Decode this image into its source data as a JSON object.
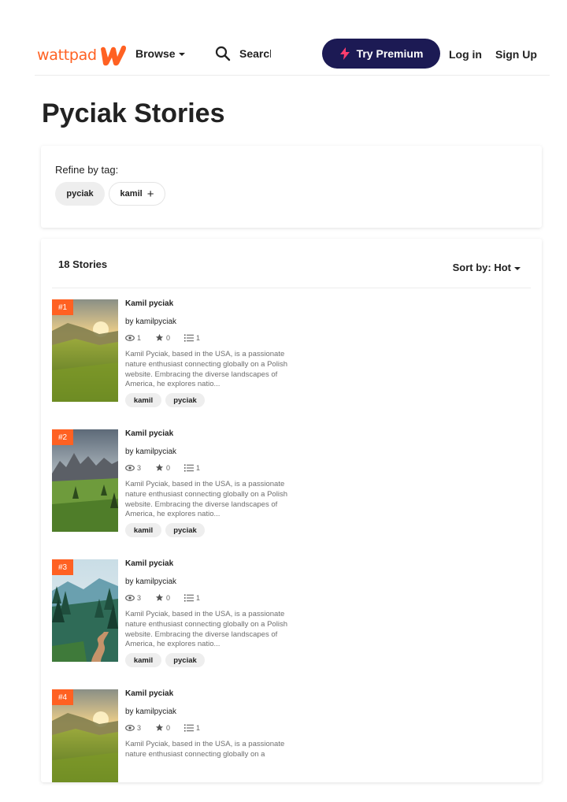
{
  "header": {
    "logo_text": "wattpad",
    "browse_label": "Browse",
    "search_placeholder": "Search",
    "premium_label": "Try Premium",
    "login_label": "Log in",
    "signup_label": "Sign Up",
    "brand_color": "#ff6122",
    "premium_color": "#1c1a54"
  },
  "page": {
    "title": "Pyciak Stories"
  },
  "refine": {
    "label": "Refine by tag:",
    "tags": [
      {
        "label": "pyciak",
        "active": true
      },
      {
        "label": "kamil",
        "active": false,
        "icon": "plus-icon"
      }
    ]
  },
  "stories": {
    "count_label": "18 Stories",
    "sort_label": "Sort by: Hot",
    "items": [
      {
        "rank": "#1",
        "title": "Kamil pyciak",
        "author": "by kamilpyciak",
        "views": "1",
        "votes": "0",
        "parts": "1",
        "description": "Kamil Pyciak, based in the USA, is a passionate nature enthusiast connecting globally on a Polish website. Embracing the diverse landscapes of America, he explores natio...",
        "tags": [
          "kamil",
          "pyciak"
        ],
        "cover": "sunset-meadow"
      },
      {
        "rank": "#2",
        "title": "Kamil pyciak",
        "author": "by kamilpyciak",
        "views": "3",
        "votes": "0",
        "parts": "1",
        "description": "Kamil Pyciak, based in the USA, is a passionate nature enthusiast connecting globally on a Polish website. Embracing the diverse landscapes of America, he explores natio...",
        "tags": [
          "kamil",
          "pyciak"
        ],
        "cover": "mountain-valley"
      },
      {
        "rank": "#3",
        "title": "Kamil pyciak",
        "author": "by kamilpyciak",
        "views": "3",
        "votes": "0",
        "parts": "1",
        "description": "Kamil Pyciak, based in the USA, is a passionate nature enthusiast connecting globally on a Polish website. Embracing the diverse landscapes of America, he explores natio...",
        "tags": [
          "kamil",
          "pyciak"
        ],
        "cover": "misty-forest"
      },
      {
        "rank": "#4",
        "title": "Kamil pyciak",
        "author": "by kamilpyciak",
        "views": "3",
        "votes": "0",
        "parts": "1",
        "description": "Kamil Pyciak, based in the USA, is a passionate nature enthusiast connecting globally on a",
        "tags": [],
        "cover": "sunset-meadow"
      }
    ]
  }
}
